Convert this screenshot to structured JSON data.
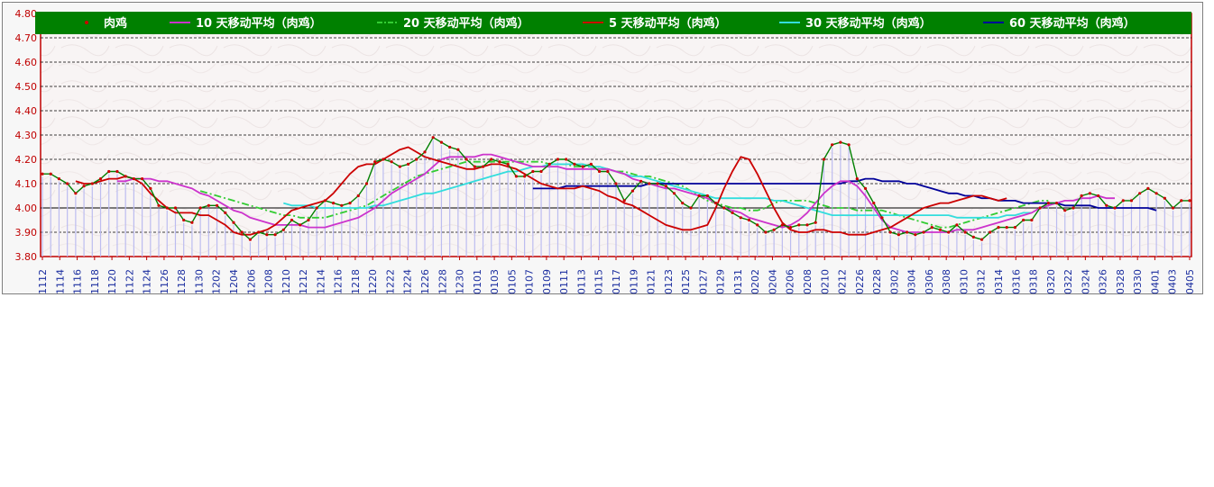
{
  "chart_data": {
    "type": "line",
    "ylim": [
      3.8,
      4.8
    ],
    "yticks": [
      "3.80",
      "3.90",
      "4.00",
      "4.10",
      "4.20",
      "4.30",
      "4.40",
      "4.50",
      "4.60",
      "4.70",
      "4.80"
    ],
    "grid": true,
    "legend_position": "top",
    "x_start": "1112",
    "x_tick_labels": [
      "1112",
      "1114",
      "1116",
      "1118",
      "1120",
      "1122",
      "1124",
      "1126",
      "1128",
      "1130",
      "1202",
      "1204",
      "1206",
      "1208",
      "1210",
      "1212",
      "1214",
      "1216",
      "1218",
      "1220",
      "1222",
      "1224",
      "1226",
      "1228",
      "1230",
      "0101",
      "0103",
      "0105",
      "0107",
      "0109",
      "0111",
      "0113",
      "0115",
      "0117",
      "0119",
      "0121",
      "0123",
      "0125",
      "0127",
      "0129",
      "0131",
      "0202",
      "0204",
      "0206",
      "0208",
      "0210",
      "0212",
      "0226",
      "0228",
      "0302",
      "0304",
      "0306",
      "0308",
      "0310",
      "0312",
      "0314",
      "0316",
      "0318",
      "0320",
      "0322",
      "0324",
      "0326",
      "0328",
      "0330",
      "0401",
      "0403",
      "0405"
    ],
    "series": [
      {
        "name": "肉鸡",
        "color": "#008000",
        "marker_color": "#cc0000",
        "style": "solid",
        "values": [
          4.14,
          4.14,
          4.12,
          4.1,
          4.06,
          4.09,
          4.1,
          4.12,
          4.15,
          4.15,
          4.13,
          4.12,
          4.12,
          4.08,
          4.01,
          4.0,
          4.0,
          3.95,
          3.94,
          4.0,
          4.01,
          4.01,
          3.98,
          3.94,
          3.9,
          3.87,
          3.9,
          3.89,
          3.89,
          3.91,
          3.95,
          3.93,
          3.95,
          4.0,
          4.03,
          4.02,
          4.01,
          4.02,
          4.05,
          4.1,
          4.19,
          4.2,
          4.19,
          4.17,
          4.18,
          4.2,
          4.23,
          4.29,
          4.27,
          4.25,
          4.24,
          4.2,
          4.17,
          4.17,
          4.2,
          4.19,
          4.18,
          4.13,
          4.13,
          4.15,
          4.15,
          4.18,
          4.2,
          4.2,
          4.18,
          4.17,
          4.18,
          4.15,
          4.15,
          4.1,
          4.03,
          4.07,
          4.11,
          4.1,
          4.1,
          4.09,
          4.06,
          4.02,
          4.0,
          4.05,
          4.05,
          4.02,
          4.0,
          3.98,
          3.96,
          3.95,
          3.93,
          3.9,
          3.91,
          3.93,
          3.92,
          3.93,
          3.93,
          3.94,
          4.2,
          4.26,
          4.27,
          4.26,
          4.12,
          4.08,
          4.02,
          3.96,
          3.9,
          3.89,
          3.9,
          3.89,
          3.9,
          3.92,
          3.91,
          3.9,
          3.93,
          3.9,
          3.88,
          3.87,
          3.9,
          3.92,
          3.92,
          3.92,
          3.95,
          3.95,
          4.0,
          4.02,
          4.02,
          3.99,
          4.0,
          4.05,
          4.06,
          4.05,
          4.01,
          4.0,
          4.03,
          4.03,
          4.06,
          4.08,
          4.06,
          4.04,
          4.0,
          4.03,
          4.03
        ]
      },
      {
        "name": "10 天移动平均（肉鸡）",
        "color": "#cc33cc",
        "style": "solid",
        "start": 9,
        "values": [
          4.11,
          4.11,
          4.12,
          4.12,
          4.12,
          4.11,
          4.11,
          4.1,
          4.09,
          4.08,
          4.06,
          4.05,
          4.03,
          4.01,
          3.99,
          3.98,
          3.96,
          3.95,
          3.94,
          3.93,
          3.93,
          3.93,
          3.93,
          3.92,
          3.92,
          3.92,
          3.93,
          3.94,
          3.95,
          3.96,
          3.98,
          4.0,
          4.03,
          4.06,
          4.08,
          4.1,
          4.12,
          4.14,
          4.17,
          4.2,
          4.21,
          4.21,
          4.21,
          4.21,
          4.22,
          4.22,
          4.21,
          4.2,
          4.19,
          4.18,
          4.17,
          4.17,
          4.17,
          4.17,
          4.16,
          4.16,
          4.16,
          4.16,
          4.16,
          4.16,
          4.15,
          4.14,
          4.12,
          4.11,
          4.1,
          4.09,
          4.08,
          4.08,
          4.07,
          4.06,
          4.05,
          4.04,
          4.02,
          4.0,
          3.99,
          3.98,
          3.96,
          3.95,
          3.94,
          3.93,
          3.92,
          3.93,
          3.95,
          3.98,
          4.02,
          4.06,
          4.09,
          4.11,
          4.11,
          4.09,
          4.05,
          4.0,
          3.95,
          3.92,
          3.91,
          3.9,
          3.9,
          3.9,
          3.9,
          3.9,
          3.9,
          3.91,
          3.91,
          3.91,
          3.92,
          3.93,
          3.94,
          3.95,
          3.96,
          3.97,
          3.98,
          4.0,
          4.01,
          4.02,
          4.03,
          4.03,
          4.04,
          4.04,
          4.05,
          4.04,
          4.04
        ]
      },
      {
        "name": "20 天移动平均（肉鸡）",
        "color": "#33cc33",
        "style": "dashdot",
        "start": 19,
        "values": [
          4.07,
          4.06,
          4.05,
          4.04,
          4.03,
          4.02,
          4.01,
          4.0,
          3.99,
          3.98,
          3.97,
          3.97,
          3.96,
          3.96,
          3.96,
          3.96,
          3.97,
          3.98,
          3.99,
          4.0,
          4.01,
          4.03,
          4.05,
          4.07,
          4.09,
          4.11,
          4.13,
          4.14,
          4.15,
          4.16,
          4.17,
          4.18,
          4.19,
          4.19,
          4.19,
          4.19,
          4.19,
          4.19,
          4.19,
          4.19,
          4.19,
          4.19,
          4.18,
          4.18,
          4.18,
          4.17,
          4.17,
          4.17,
          4.16,
          4.16,
          4.15,
          4.15,
          4.14,
          4.13,
          4.13,
          4.12,
          4.11,
          4.1,
          4.09,
          4.07,
          4.05,
          4.03,
          4.02,
          4.01,
          4.0,
          4.0,
          3.99,
          3.99,
          4.0,
          4.02,
          4.03,
          4.03,
          4.03,
          4.03,
          4.02,
          4.01,
          4.0,
          4.0,
          4.0,
          3.99,
          3.99,
          3.99,
          3.99,
          3.98,
          3.97,
          3.96,
          3.95,
          3.94,
          3.93,
          3.92,
          3.92,
          3.93,
          3.94,
          3.95,
          3.96,
          3.97,
          3.98,
          3.99,
          4.0,
          4.01,
          4.02,
          4.03,
          4.03
        ]
      },
      {
        "name": "5 天移动平均（肉鸡）",
        "color": "#cc0000",
        "style": "solid",
        "start": 4,
        "values": [
          4.11,
          4.1,
          4.1,
          4.11,
          4.12,
          4.12,
          4.13,
          4.12,
          4.1,
          4.06,
          4.03,
          4.0,
          3.98,
          3.98,
          3.98,
          3.97,
          3.97,
          3.95,
          3.93,
          3.9,
          3.89,
          3.89,
          3.9,
          3.91,
          3.93,
          3.96,
          3.99,
          4.0,
          4.01,
          4.02,
          4.03,
          4.06,
          4.1,
          4.14,
          4.17,
          4.18,
          4.18,
          4.2,
          4.22,
          4.24,
          4.25,
          4.23,
          4.21,
          4.2,
          4.19,
          4.18,
          4.17,
          4.16,
          4.16,
          4.17,
          4.18,
          4.18,
          4.17,
          4.16,
          4.14,
          4.12,
          4.1,
          4.09,
          4.08,
          4.08,
          4.08,
          4.09,
          4.08,
          4.07,
          4.05,
          4.04,
          4.02,
          4.01,
          3.99,
          3.97,
          3.95,
          3.93,
          3.92,
          3.91,
          3.91,
          3.92,
          3.93,
          4.0,
          4.08,
          4.15,
          4.21,
          4.2,
          4.14,
          4.07,
          4.0,
          3.94,
          3.91,
          3.9,
          3.9,
          3.91,
          3.91,
          3.9,
          3.9,
          3.89,
          3.89,
          3.89,
          3.9,
          3.91,
          3.92,
          3.94,
          3.96,
          3.98,
          4.0,
          4.01,
          4.02,
          4.02,
          4.03,
          4.04,
          4.05,
          4.05,
          4.04,
          4.03,
          4.04
        ]
      },
      {
        "name": "30 天移动平均（肉鸡）",
        "color": "#33dddd",
        "style": "solid",
        "start": 29,
        "values": [
          4.02,
          4.01,
          4.01,
          4.01,
          4.0,
          4.0,
          4.0,
          4.0,
          4.0,
          4.0,
          4.0,
          4.01,
          4.01,
          4.02,
          4.03,
          4.04,
          4.05,
          4.06,
          4.06,
          4.07,
          4.08,
          4.09,
          4.1,
          4.11,
          4.12,
          4.13,
          4.14,
          4.15,
          4.15,
          4.16,
          4.17,
          4.17,
          4.18,
          4.18,
          4.18,
          4.18,
          4.18,
          4.17,
          4.17,
          4.16,
          4.15,
          4.14,
          4.13,
          4.13,
          4.12,
          4.11,
          4.1,
          4.09,
          4.08,
          4.07,
          4.06,
          4.05,
          4.04,
          4.04,
          4.04,
          4.04,
          4.04,
          4.04,
          4.04,
          4.03,
          4.03,
          4.02,
          4.01,
          4.0,
          3.99,
          3.98,
          3.97,
          3.97,
          3.97,
          3.97,
          3.97,
          3.97,
          3.97,
          3.97,
          3.97,
          3.97,
          3.97,
          3.97,
          3.97,
          3.97,
          3.97,
          3.96,
          3.96,
          3.96,
          3.96,
          3.96,
          3.96,
          3.97,
          3.97,
          3.98,
          3.98
        ]
      },
      {
        "name": "60 天移动平均（肉鸡）",
        "color": "#000099",
        "style": "solid",
        "start": 59,
        "values": [
          4.08,
          4.08,
          4.08,
          4.08,
          4.09,
          4.09,
          4.09,
          4.09,
          4.09,
          4.09,
          4.09,
          4.09,
          4.09,
          4.09,
          4.1,
          4.1,
          4.1,
          4.1,
          4.1,
          4.1,
          4.1,
          4.1,
          4.1,
          4.1,
          4.1,
          4.1,
          4.1,
          4.1,
          4.1,
          4.1,
          4.1,
          4.1,
          4.1,
          4.1,
          4.1,
          4.1,
          4.1,
          4.1,
          4.11,
          4.11,
          4.12,
          4.12,
          4.11,
          4.11,
          4.11,
          4.1,
          4.1,
          4.09,
          4.08,
          4.07,
          4.06,
          4.06,
          4.05,
          4.05,
          4.04,
          4.04,
          4.03,
          4.03,
          4.03,
          4.02,
          4.02,
          4.02,
          4.02,
          4.02,
          4.01,
          4.01,
          4.01,
          4.01,
          4.0,
          4.0,
          4.0,
          4.0,
          4.0,
          4.0,
          4.0,
          3.99
        ]
      }
    ]
  }
}
